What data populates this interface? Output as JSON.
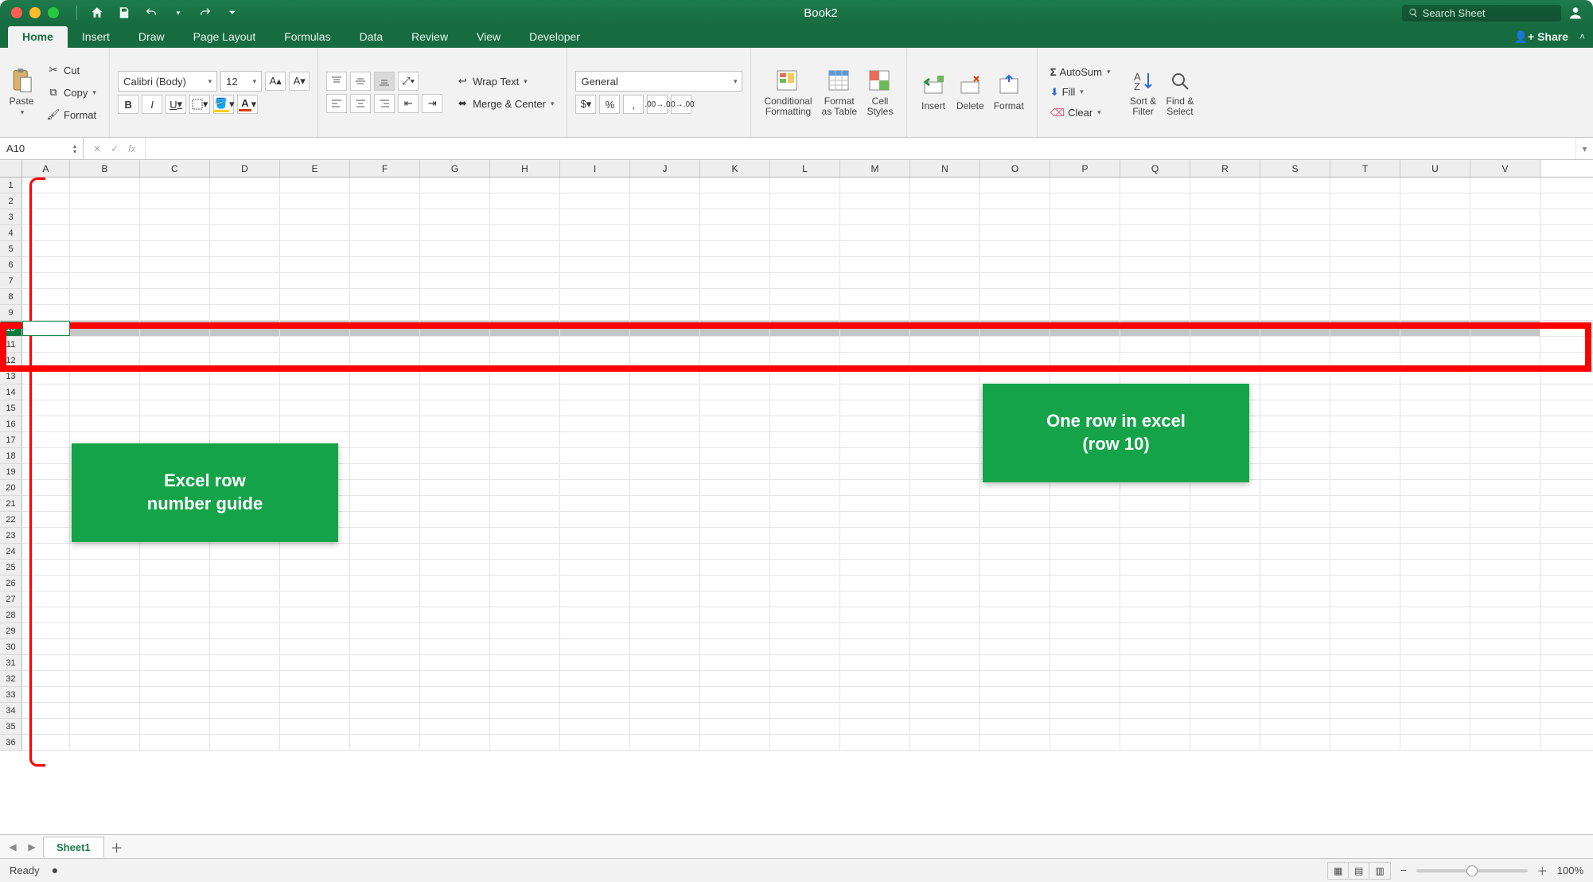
{
  "window": {
    "title": "Book2",
    "search_placeholder": "Search Sheet"
  },
  "tabs": [
    "Home",
    "Insert",
    "Draw",
    "Page Layout",
    "Formulas",
    "Data",
    "Review",
    "View",
    "Developer"
  ],
  "share_label": "Share",
  "clipboard": {
    "paste": "Paste",
    "cut": "Cut",
    "copy": "Copy",
    "format": "Format"
  },
  "font": {
    "name": "Calibri (Body)",
    "size": "12",
    "bold": "B",
    "italic": "I",
    "underline": "U"
  },
  "alignment": {
    "wrap": "Wrap Text",
    "merge": "Merge & Center"
  },
  "number": {
    "format": "General"
  },
  "styles": {
    "cf": "Conditional\nFormatting",
    "fat": "Format\nas Table",
    "cs": "Cell\nStyles"
  },
  "cells": {
    "insert": "Insert",
    "delete": "Delete",
    "format": "Format"
  },
  "editing": {
    "autosum": "AutoSum",
    "fill": "Fill",
    "clear": "Clear",
    "sort": "Sort &\nFilter",
    "find": "Find &\nSelect"
  },
  "name_box": "A10",
  "fx": "fx",
  "columns": [
    "A",
    "B",
    "C",
    "D",
    "E",
    "F",
    "G",
    "H",
    "I",
    "J",
    "K",
    "L",
    "M",
    "N",
    "O",
    "P",
    "Q",
    "R",
    "S",
    "T",
    "U",
    "V"
  ],
  "row_count": 36,
  "selected_row": 10,
  "annotations": {
    "row_guide": "Excel row\nnumber guide",
    "one_row": "One row in excel\n(row 10)"
  },
  "sheet_tab": "Sheet1",
  "status": {
    "ready": "Ready",
    "zoom": "100%"
  }
}
